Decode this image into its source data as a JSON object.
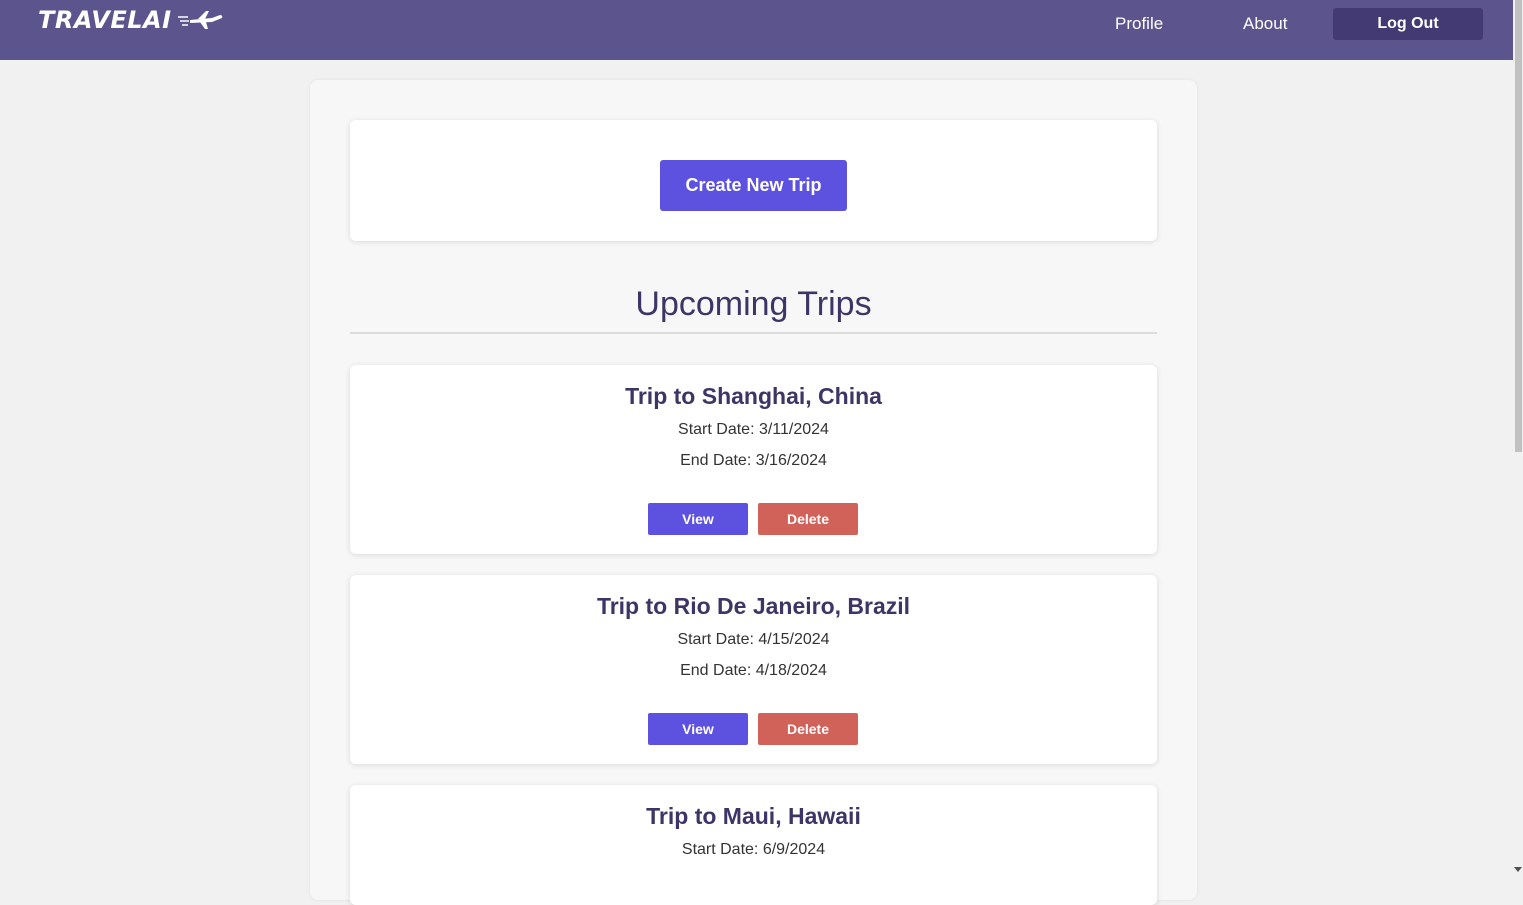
{
  "nav": {
    "logo_text": "TRAVELAI",
    "profile_label": "Profile",
    "about_label": "About",
    "logout_label": "Log Out"
  },
  "create": {
    "button_label": "Create New Trip"
  },
  "upcoming": {
    "title": "Upcoming Trips",
    "trips": [
      {
        "title": "Trip to Shanghai, China",
        "start_date": "Start Date: 3/11/2024",
        "end_date": "End Date: 3/16/2024",
        "view_label": "View",
        "delete_label": "Delete"
      },
      {
        "title": "Trip to Rio De Janeiro, Brazil",
        "start_date": "Start Date: 4/15/2024",
        "end_date": "End Date: 4/18/2024",
        "view_label": "View",
        "delete_label": "Delete"
      },
      {
        "title": "Trip to Maui, Hawaii",
        "start_date": "Start Date: 6/9/2024"
      }
    ]
  },
  "colors": {
    "nav_bg": "#5c548c",
    "logout_bg": "#443a73",
    "primary_button": "#5d52e0",
    "delete_button": "#d1625a",
    "heading_text": "#3e3566"
  },
  "icons": {
    "logo": "airplane-icon"
  }
}
